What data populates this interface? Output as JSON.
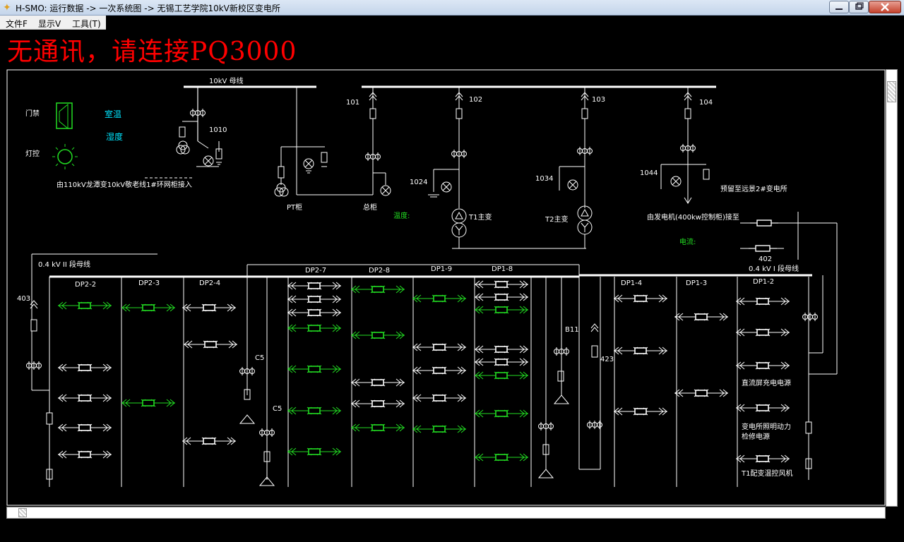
{
  "window": {
    "title": "H-SMO: 运行数据 -> 一次系统图 -> 无锡工艺学院10kV新校区变电所"
  },
  "menu": {
    "file": "文件F",
    "view": "显示V",
    "tools": "工具(T)"
  },
  "alarm_text": "无通讯，请连接PQ3000",
  "legend": {
    "door": "门禁",
    "light": "灯控",
    "room_temp": "室温",
    "humidity": "湿度"
  },
  "hv": {
    "bus_label": "10kV 母线",
    "feeders": [
      "101",
      "102",
      "103",
      "104"
    ],
    "earth_switches": [
      "1010",
      "1024",
      "1034",
      "1044"
    ],
    "pt_cabinet": "PT柜",
    "main_cabinet": "总柜",
    "incoming": "由110kV龙潭变10kV敬老线1#环网柜接入",
    "reserved": "预留至远景2#变电所",
    "t1": "T1主变",
    "t2": "T2主变",
    "temp_label": "温度:",
    "current_label": "电流:",
    "generator": "由发电机(400kw控制柜)接至"
  },
  "lv": {
    "bus2": "0.4 kV II 段母线",
    "bus1": "0.4 kV I 段母线",
    "breaker_402": "402",
    "breaker_403": "403",
    "breaker_423": "423",
    "b11": "B11",
    "c5": "C5",
    "panels": [
      "DP2-2",
      "DP2-3",
      "DP2-4",
      "DP2-7",
      "DP2-8",
      "DP1-9",
      "DP1-8",
      "DP1-4",
      "DP1-3",
      "DP1-2"
    ],
    "loads": {
      "dc_panel": "直流屏充电电源",
      "lighting_1": "变电所照明动力",
      "lighting_2": "检修电源",
      "t1_fan": "T1配变温控风机"
    }
  },
  "colors": {
    "alarm": "#ff0000",
    "active": "#22dd22",
    "inactive": "#ffffff",
    "cyan": "#00e5ff",
    "line": "#ffffff"
  }
}
